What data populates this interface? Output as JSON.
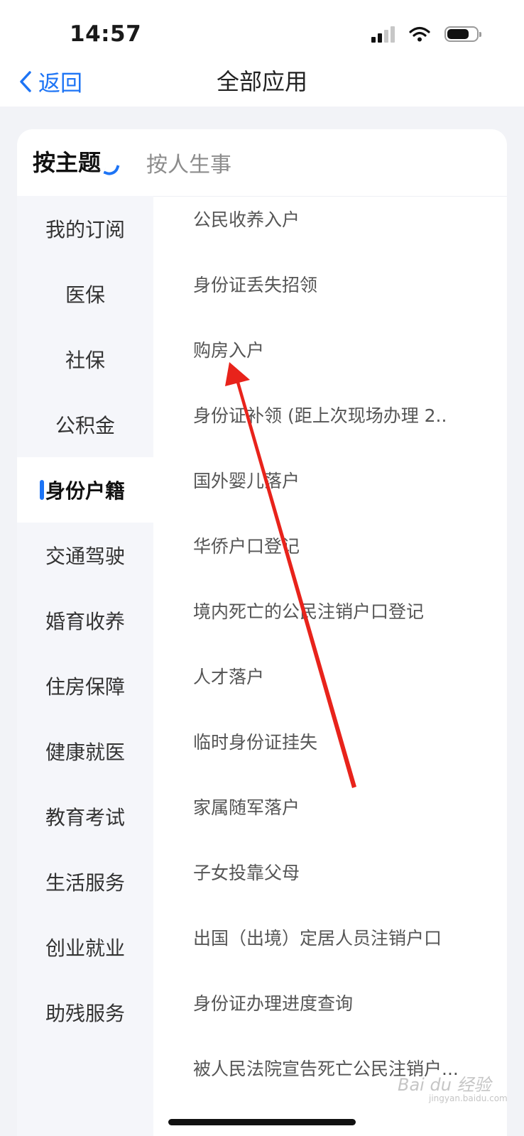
{
  "status_bar": {
    "time": "14:57",
    "signal_icon": "cellular-signal-icon",
    "wifi_icon": "wifi-icon",
    "battery_icon": "battery-icon"
  },
  "nav": {
    "back_label": "返回",
    "back_icon": "chevron-left-icon",
    "title": "全部应用"
  },
  "tabs": {
    "active": "按主题",
    "inactive": "按人生事"
  },
  "sidebar": {
    "items": [
      "我的订阅",
      "医保",
      "社保",
      "公积金",
      "身份户籍",
      "交通驾驶",
      "婚育收养",
      "住房保障",
      "健康就医",
      "教育考试",
      "生活服务",
      "创业就业",
      "助残服务"
    ],
    "selected": "身份户籍"
  },
  "content": {
    "items": [
      "公民收养入户",
      "身份证丢失招领",
      "购房入户",
      "身份证补领 (距上次现场办理 2..",
      "国外婴儿落户",
      "华侨户口登记",
      "境内死亡的公民注销户口登记",
      "人才落户",
      "临时身份证挂失",
      "家属随军落户",
      "子女投靠父母",
      "出国（出境）定居人员注销户口",
      "身份证办理进度查询",
      "被人民法院宣告死亡公民注销户..."
    ]
  },
  "watermark": {
    "text": "Bai du 经验",
    "sub": "jingyan.baidu.com"
  },
  "colors": {
    "accent": "#1d74f5",
    "annotation_arrow": "#e8231b"
  }
}
